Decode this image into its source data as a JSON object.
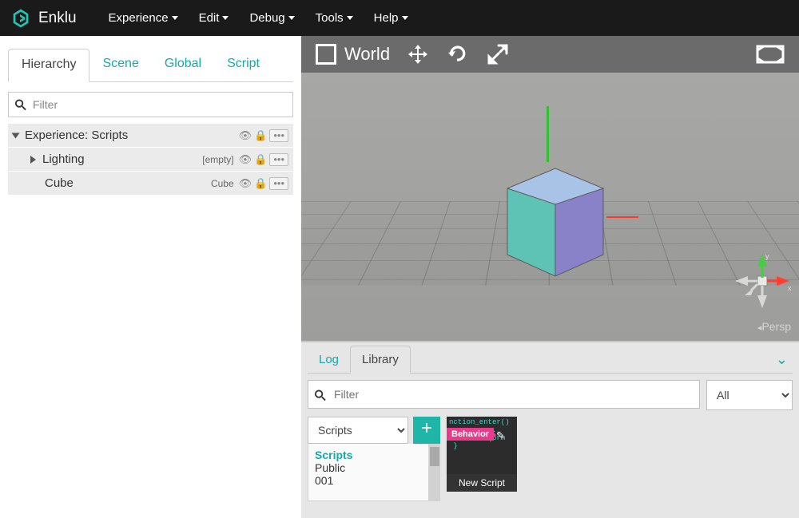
{
  "app": {
    "name": "Enklu"
  },
  "nav": {
    "items": [
      "Experience",
      "Edit",
      "Debug",
      "Tools",
      "Help"
    ]
  },
  "left_panel": {
    "tabs": [
      "Hierarchy",
      "Scene",
      "Global",
      "Script"
    ],
    "active_tab": 0,
    "filter_placeholder": "Filter",
    "hierarchy": [
      {
        "label": "Experience: Scripts",
        "expanded": true,
        "tag": "",
        "indent": 0
      },
      {
        "label": "Lighting",
        "expanded": false,
        "tag": "[empty]",
        "indent": 1
      },
      {
        "label": "Cube",
        "expanded": null,
        "tag": "Cube",
        "indent": 1
      }
    ]
  },
  "viewport": {
    "space_label": "World",
    "camera_label": "Persp"
  },
  "bottom_panel": {
    "tabs": [
      "Log",
      "Library"
    ],
    "active_tab": 1,
    "filter_placeholder": "Filter",
    "filter_dropdown": "All",
    "category_dropdown": "Scripts",
    "categories": [
      "Scripts",
      "Public",
      "001"
    ],
    "asset": {
      "badge": "Behavior",
      "label": "New Script",
      "code_preview": "nction_enter()\n          .\n    transform\n }"
    }
  }
}
